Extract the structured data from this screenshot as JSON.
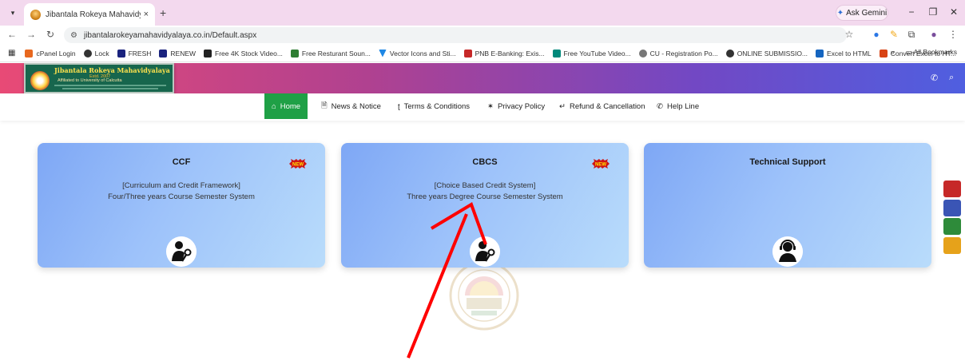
{
  "browser": {
    "tab_title": "Jibantala Rokeya Mahavidyala",
    "tab_close": "×",
    "new_tab": "+",
    "address": "jibantalarokeyamahavidyalaya.co.in/Default.aspx",
    "gemini_label": "Ask Gemini",
    "bookmarks": [
      {
        "label": "cPanel Login",
        "color": "#e8681f"
      },
      {
        "label": "Lock",
        "color": "#333333"
      },
      {
        "label": "FRESH",
        "color": "#1a237e"
      },
      {
        "label": "RENEW",
        "color": "#1a237e"
      },
      {
        "label": "Free 4K Stock Video...",
        "color": "#222222"
      },
      {
        "label": "Free Resturant Soun...",
        "color": "#2e7d32"
      },
      {
        "label": "Vector Icons and Sti...",
        "color": "#1e88e5"
      },
      {
        "label": "PNB E-Banking: Exis...",
        "color": "#c62828"
      },
      {
        "label": "Free YouTube Video...",
        "color": "#00897b"
      },
      {
        "label": "CU - Registration Po...",
        "color": "#777777"
      },
      {
        "label": "ONLINE SUBMISSIO...",
        "color": "#333333"
      },
      {
        "label": "Excel to HTML",
        "color": "#1565c0"
      },
      {
        "label": "Convert Excel to HT...",
        "color": "#d84315"
      }
    ],
    "bookmarks_more": "»",
    "all_bookmarks": "All Bookmarks"
  },
  "header": {
    "logo_name": "Jibantala Rokeya Mahavidyalaya",
    "logo_estd": "Estd. 2007",
    "logo_affiliation": "Affiliated to University of Calcutta"
  },
  "menu": {
    "items": [
      {
        "label": "Home",
        "icon": "home-icon"
      },
      {
        "label": "News & Notice",
        "icon": "document-icon"
      },
      {
        "label": "Terms & Conditions",
        "icon": "terms-icon"
      },
      {
        "label": "Privacy Policy",
        "icon": "privacy-icon"
      },
      {
        "label": "Refund & Cancellation",
        "icon": "return-icon"
      },
      {
        "label": "Help Line",
        "icon": "phone-icon"
      }
    ]
  },
  "cards": [
    {
      "title": "CCF",
      "subtitle": "[Curriculum and Credit Framework]",
      "description": "Four/Three years Course Semester System",
      "badge": "NEW",
      "icon": "user-key-icon"
    },
    {
      "title": "CBCS",
      "subtitle": "[Choice Based Credit System]",
      "description": "Three years Degree Course Semester System",
      "badge": "NEW",
      "icon": "user-key-icon"
    },
    {
      "title": "Technical Support",
      "subtitle": "",
      "description": "",
      "badge": "",
      "icon": "headset-support-icon"
    }
  ],
  "colors": {
    "header_gradient": [
      "#e84a76",
      "#7248c4",
      "#4f5fe0"
    ],
    "menu_active": "#1fa046",
    "card_gradient": [
      "#7ea7f5",
      "#b9dcfb"
    ],
    "annotation_arrow": "#ff0000"
  }
}
